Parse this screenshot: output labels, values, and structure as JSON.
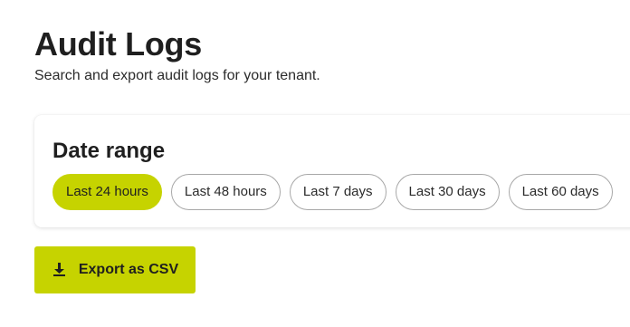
{
  "page": {
    "title": "Audit Logs",
    "subtitle": "Search and export audit logs for your tenant."
  },
  "date_range": {
    "title": "Date range",
    "selected": "Last 24 hours",
    "options": [
      {
        "label": "Last 24 hours",
        "selected": true
      },
      {
        "label": "Last 48 hours",
        "selected": false
      },
      {
        "label": "Last 7 days",
        "selected": false
      },
      {
        "label": "Last 30 days",
        "selected": false
      },
      {
        "label": "Last 60 days",
        "selected": false
      }
    ]
  },
  "actions": {
    "export": {
      "label": "Export as CSV",
      "icon": "download-icon"
    }
  },
  "colors": {
    "accent": "#c6d300",
    "text": "#1f1f1f",
    "chip_border": "#a8a8a8"
  }
}
